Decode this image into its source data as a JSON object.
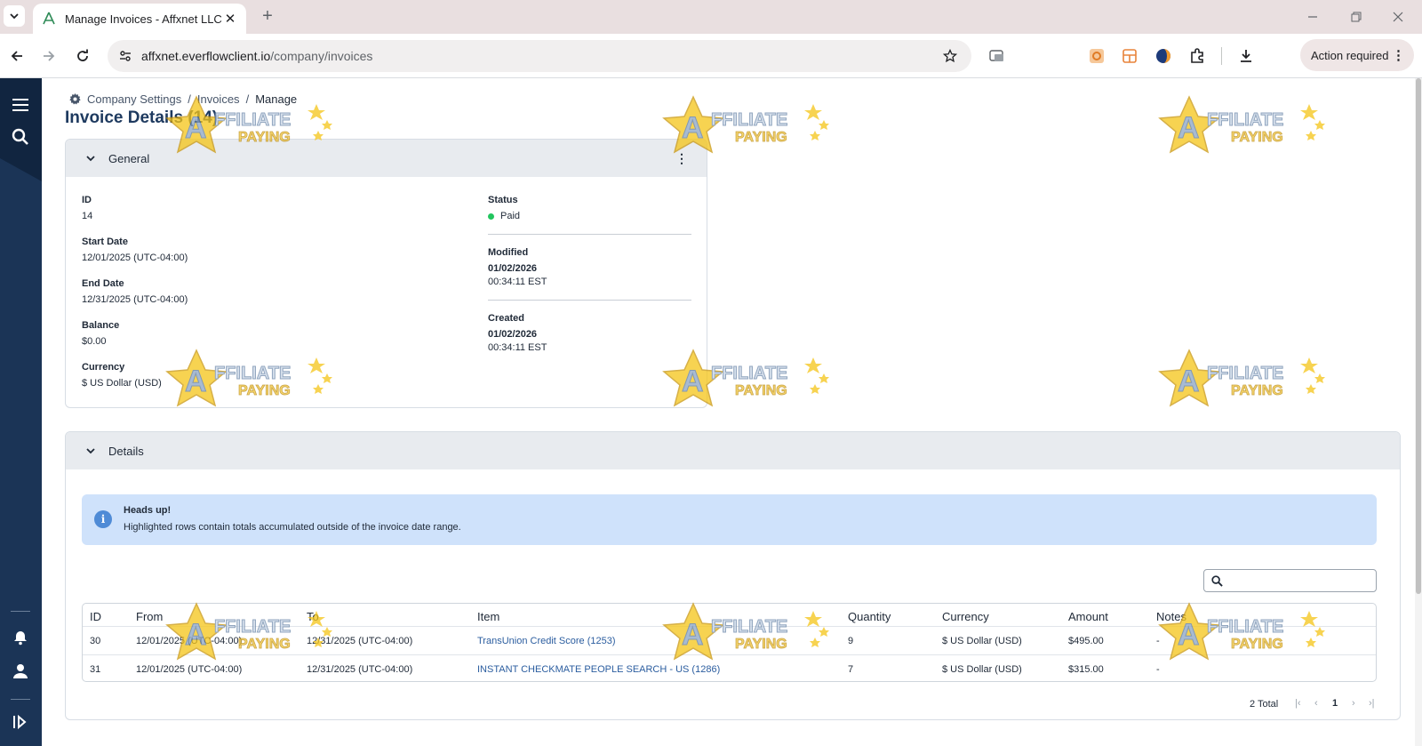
{
  "browser": {
    "tab_title": "Manage Invoices - Affxnet LLC",
    "url_host": "affxnet.everflowclient.io",
    "url_path": "/company/invoices",
    "action_required": "Action required"
  },
  "breadcrumb": {
    "items": [
      "Company Settings",
      "Invoices",
      "Manage"
    ],
    "separator": "/"
  },
  "page_title": "Invoice Details (14)",
  "general": {
    "title": "General",
    "id_label": "ID",
    "id_value": "14",
    "start_label": "Start Date",
    "start_value": "12/01/2025 (UTC-04:00)",
    "end_label": "End Date",
    "end_value": "12/31/2025 (UTC-04:00)",
    "balance_label": "Balance",
    "balance_value": "$0.00",
    "currency_label": "Currency",
    "currency_value": "$ US Dollar (USD)",
    "status_label": "Status",
    "status_value": "Paid",
    "status_color": "#22c55e",
    "modified_label": "Modified",
    "modified_date": "01/02/2026",
    "modified_time": "00:34:11 EST",
    "created_label": "Created",
    "created_date": "01/02/2026",
    "created_time": "00:34:11 EST"
  },
  "details": {
    "title": "Details",
    "alert_title": "Heads up!",
    "alert_text": "Highlighted rows contain totals accumulated outside of the invoice date range.",
    "columns": [
      "ID",
      "From",
      "To",
      "Item",
      "Quantity",
      "Currency",
      "Amount",
      "Notes"
    ],
    "rows": [
      {
        "id": "30",
        "from": "12/01/2025 (UTC-04:00)",
        "to": "12/31/2025 (UTC-04:00)",
        "item": "TransUnion Credit Score (1253)",
        "quantity": "9",
        "currency": "$ US Dollar (USD)",
        "amount": "$495.00",
        "notes": "-"
      },
      {
        "id": "31",
        "from": "12/01/2025 (UTC-04:00)",
        "to": "12/31/2025 (UTC-04:00)",
        "item": "INSTANT CHECKMATE PEOPLE SEARCH - US (1286)",
        "quantity": "7",
        "currency": "$ US Dollar (USD)",
        "amount": "$315.00",
        "notes": "-"
      }
    ],
    "total": "2 Total",
    "page": "1"
  },
  "watermark": "AFFILIATE PAYING"
}
